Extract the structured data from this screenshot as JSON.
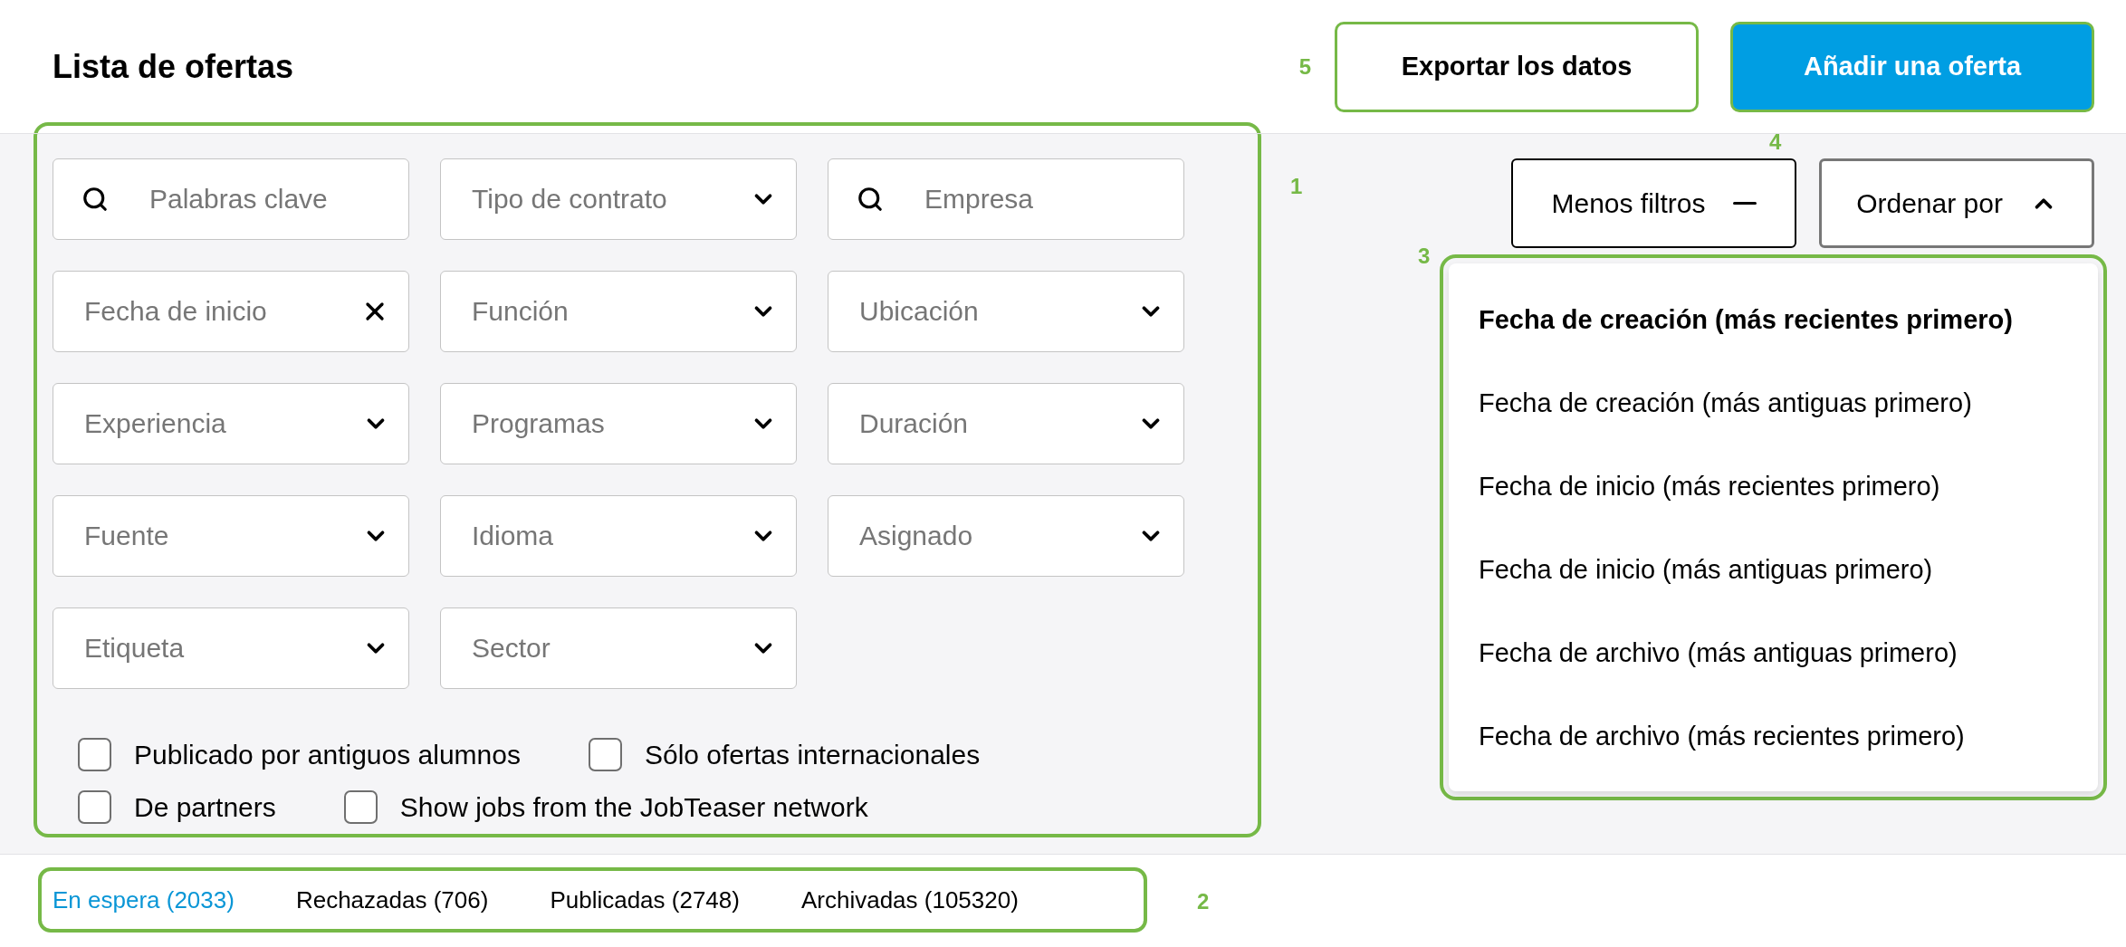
{
  "header": {
    "title": "Lista de ofertas",
    "buttons": [
      {
        "label": "Exportar los datos",
        "kind": "secondary",
        "marker": "5"
      },
      {
        "label": "Añadir una oferta",
        "kind": "primary",
        "marker": "4"
      }
    ]
  },
  "filters": {
    "marker": "1",
    "fields": [
      {
        "kind": "search",
        "placeholder": "Palabras clave"
      },
      {
        "kind": "select",
        "placeholder": "Tipo de contrato"
      },
      {
        "kind": "search",
        "placeholder": "Empresa"
      },
      {
        "kind": "clearable",
        "placeholder": "Fecha de inicio"
      },
      {
        "kind": "select",
        "placeholder": "Función"
      },
      {
        "kind": "select",
        "placeholder": "Ubicación"
      },
      {
        "kind": "select",
        "placeholder": "Experiencia"
      },
      {
        "kind": "select",
        "placeholder": "Programas"
      },
      {
        "kind": "select",
        "placeholder": "Duración"
      },
      {
        "kind": "select",
        "placeholder": "Fuente"
      },
      {
        "kind": "select",
        "placeholder": "Idioma"
      },
      {
        "kind": "select",
        "placeholder": "Asignado"
      },
      {
        "kind": "select",
        "placeholder": "Etiqueta"
      },
      {
        "kind": "select",
        "placeholder": "Sector"
      }
    ],
    "checkbox_rows": [
      [
        {
          "label": "Publicado por antiguos alumnos",
          "checked": false
        },
        {
          "label": "Sólo ofertas internacionales",
          "checked": false
        }
      ],
      [
        {
          "label": "De partners",
          "checked": false
        },
        {
          "label": "Show jobs from the JobTeaser network",
          "checked": false
        }
      ]
    ]
  },
  "toolbar": {
    "buttons": [
      {
        "label": "Menos filtros",
        "kind": "collapse"
      },
      {
        "label": "Ordenar por",
        "kind": "sort",
        "expanded": true
      }
    ]
  },
  "sort_menu": {
    "marker": "3",
    "options": [
      {
        "label": "Fecha de creación (más recientes primero)",
        "selected": true
      },
      {
        "label": "Fecha de creación (más antiguas primero)",
        "selected": false
      },
      {
        "label": "Fecha de inicio (más recientes primero)",
        "selected": false
      },
      {
        "label": "Fecha de inicio (más antiguas primero)",
        "selected": false
      },
      {
        "label": "Fecha de archivo (más antiguas primero)",
        "selected": false
      },
      {
        "label": "Fecha de archivo (más recientes primero)",
        "selected": false
      }
    ]
  },
  "tabs": {
    "marker": "2",
    "items": [
      {
        "label": "En espera (2033)",
        "selected": true
      },
      {
        "label": "Rechazadas (706)",
        "selected": false
      },
      {
        "label": "Publicadas (2748)",
        "selected": false
      },
      {
        "label": "Archivadas (105320)",
        "selected": false
      }
    ]
  }
}
